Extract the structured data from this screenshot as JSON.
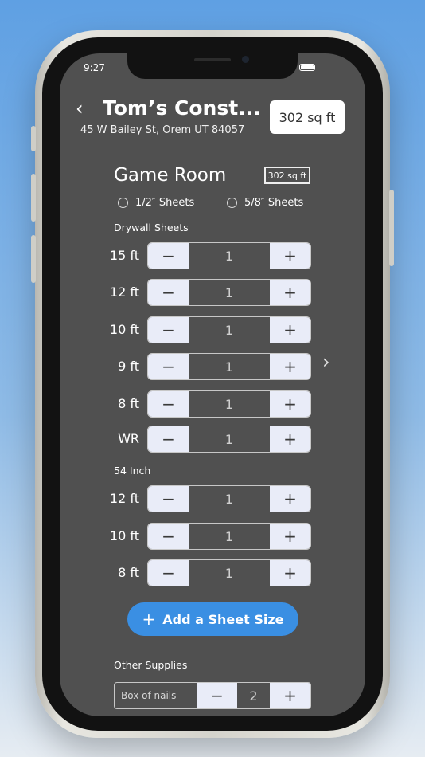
{
  "status_bar": {
    "time": "9:27"
  },
  "header": {
    "back_icon": "‹",
    "title": "Tom’s Const...",
    "address": "45 W Bailey St, Orem UT 84057",
    "sqft": "302 sq ft"
  },
  "room": {
    "name": "Game Room",
    "sqft": "302 sq ft",
    "options": [
      {
        "label": "1/2″ Sheets",
        "selected": false
      },
      {
        "label": "5/8″ Sheets",
        "selected": false
      }
    ]
  },
  "drywall": {
    "label": "Drywall Sheets",
    "rows": [
      {
        "label": "15 ft",
        "value": "1"
      },
      {
        "label": "12 ft",
        "value": "1"
      },
      {
        "label": "10 ft",
        "value": "1"
      },
      {
        "label": "9 ft",
        "value": "1"
      },
      {
        "label": "8 ft",
        "value": "1"
      },
      {
        "label": "WR",
        "value": "1"
      }
    ]
  },
  "inch54": {
    "label": "54 Inch",
    "rows": [
      {
        "label": "12 ft",
        "value": "1"
      },
      {
        "label": "10 ft",
        "value": "1"
      },
      {
        "label": "8 ft",
        "value": "1"
      }
    ]
  },
  "stepper": {
    "minus": "−",
    "plus": "+"
  },
  "next_icon": "›",
  "add_button": {
    "icon": "+",
    "label": "Add a Sheet Size"
  },
  "supplies": {
    "label": "Other Supplies",
    "item": {
      "name": "Box of nails",
      "value": "2"
    }
  }
}
